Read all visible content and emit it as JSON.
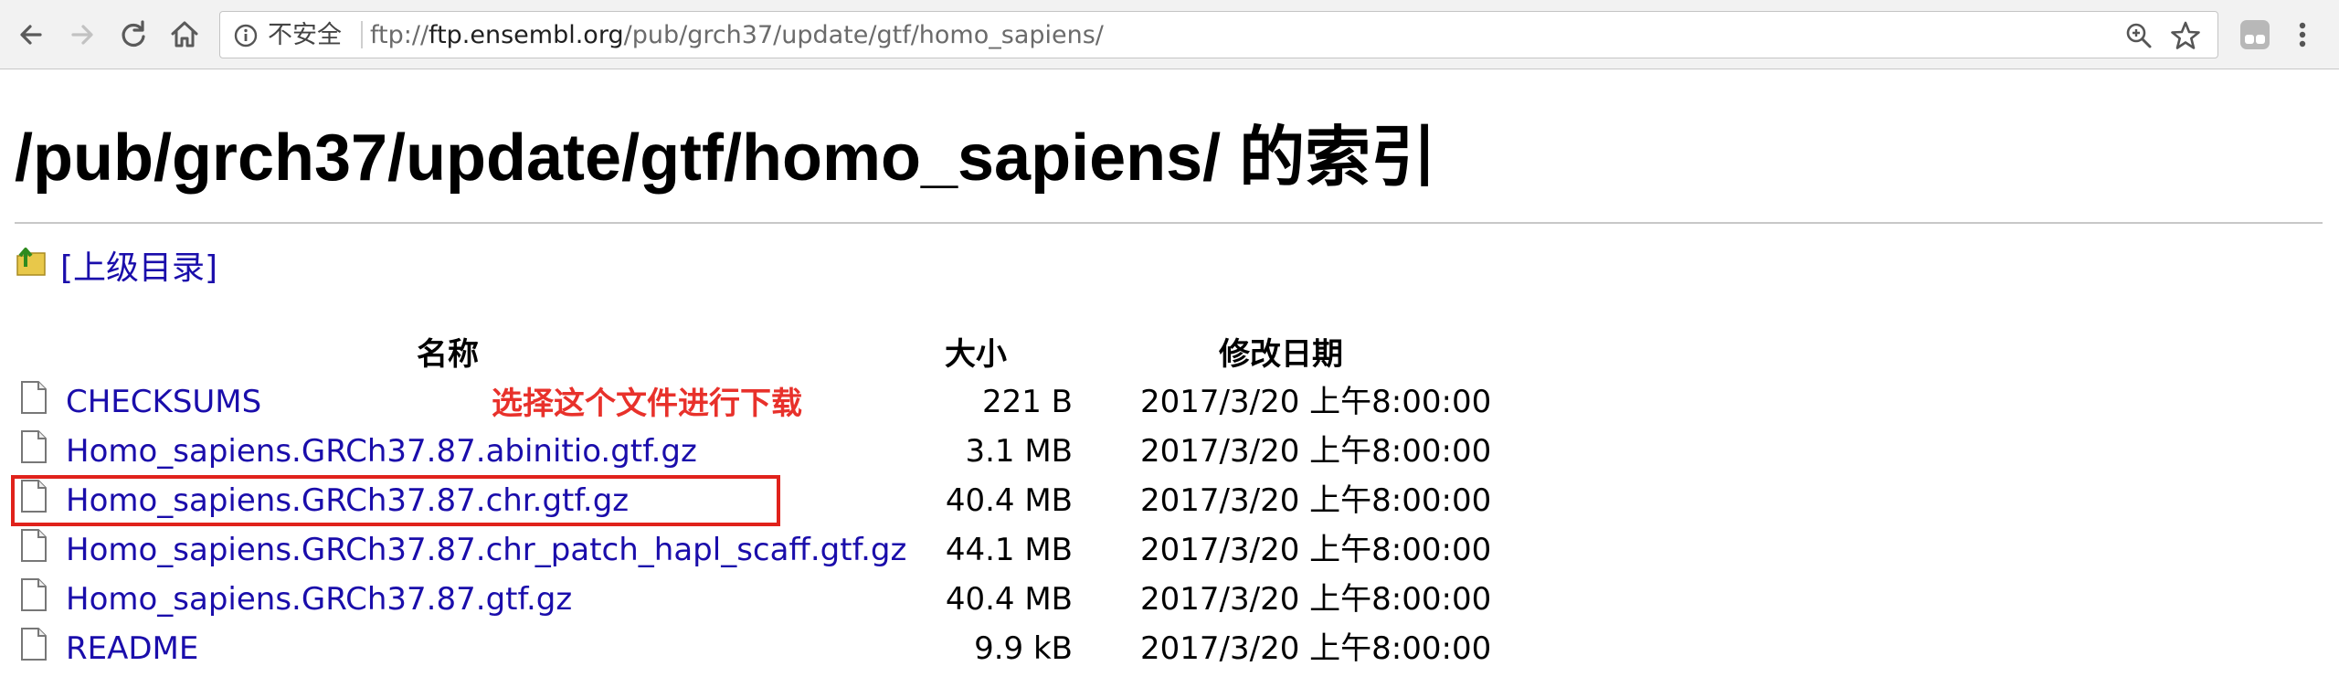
{
  "browser": {
    "security_label": "不安全",
    "url_scheme": "ftp://",
    "url_host": "ftp.ensembl.org",
    "url_path": "/pub/grch37/update/gtf/homo_sapiens/"
  },
  "page": {
    "title": "/pub/grch37/update/gtf/homo_sapiens/ 的索引",
    "parent_link": "[上级目录]",
    "headers": {
      "name": "名称",
      "size": "大小",
      "date": "修改日期"
    },
    "files": [
      {
        "name": "CHECKSUMS",
        "size": "221 B",
        "date": "2017/3/20 上午8:00:00"
      },
      {
        "name": "Homo_sapiens.GRCh37.87.abinitio.gtf.gz",
        "size": "3.1 MB",
        "date": "2017/3/20 上午8:00:00"
      },
      {
        "name": "Homo_sapiens.GRCh37.87.chr.gtf.gz",
        "size": "40.4 MB",
        "date": "2017/3/20 上午8:00:00"
      },
      {
        "name": "Homo_sapiens.GRCh37.87.chr_patch_hapl_scaff.gtf.gz",
        "size": "44.1 MB",
        "date": "2017/3/20 上午8:00:00"
      },
      {
        "name": "Homo_sapiens.GRCh37.87.gtf.gz",
        "size": "40.4 MB",
        "date": "2017/3/20 上午8:00:00"
      },
      {
        "name": "README",
        "size": "9.9 kB",
        "date": "2017/3/20 上午8:00:00"
      }
    ],
    "annotation": "选择这个文件进行下载"
  },
  "colors": {
    "link": "#1a0dab",
    "annotation": "#e8312b",
    "chrome_bg": "#f2f2f2"
  },
  "icons": [
    "back-arrow-icon",
    "forward-arrow-icon",
    "reload-icon",
    "home-icon",
    "info-icon",
    "zoom-icon",
    "star-icon",
    "extension-icon",
    "menu-dots-icon",
    "folder-up-icon",
    "file-icon"
  ]
}
